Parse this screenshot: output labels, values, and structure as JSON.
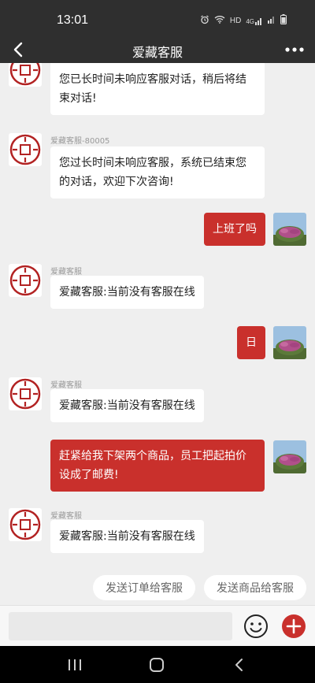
{
  "status_bar": {
    "time": "13:01",
    "icons": [
      "alarm-icon",
      "wifi-icon",
      "hd-icon",
      "signal-4g-icon",
      "signal-icon",
      "battery-icon"
    ],
    "hd_text": "HD",
    "net_text": "4G"
  },
  "header": {
    "title": "爱藏客服",
    "back_icon": "chevron-left-icon",
    "more_icon": "more-dots-icon"
  },
  "messages": [
    {
      "side": "left",
      "sender": "",
      "text_lines": [
        "您已长时间未响应客服对话，稍后将结",
        "束对话!"
      ]
    },
    {
      "side": "left",
      "sender": "爱藏客服-80005",
      "text_lines": [
        "您过长时间未响应客服，系统已结束您",
        "的对话，欢迎下次咨询!"
      ]
    },
    {
      "side": "right",
      "text_lines": [
        "上班了吗"
      ]
    },
    {
      "side": "left",
      "sender": "爱藏客服",
      "text_lines": [
        "爱藏客服:当前没有客服在线"
      ]
    },
    {
      "side": "right",
      "text_lines": [
        "日"
      ]
    },
    {
      "side": "left",
      "sender": "爱藏客服",
      "text_lines": [
        "爱藏客服:当前没有客服在线"
      ]
    },
    {
      "side": "right",
      "text_lines": [
        "赶紧给我下架两个商品，员工把起拍价",
        "设成了邮费!"
      ]
    },
    {
      "side": "left",
      "sender": "爱藏客服",
      "text_lines": [
        "爱藏客服:当前没有客服在线"
      ]
    }
  ],
  "quick_actions": {
    "send_order": "发送订单给客服",
    "send_product": "发送商品给客服"
  },
  "input_bar": {
    "value": "",
    "placeholder": "",
    "emoji_icon": "emoji-smile-icon",
    "plus_icon": "plus-circle-icon"
  },
  "system_nav": {
    "recents_icon": "recents-icon",
    "home_icon": "home-icon",
    "back_icon": "back-icon"
  },
  "colors": {
    "top_bar": "#2f2f2f",
    "accent": "#c9302c",
    "chat_bg": "#efefef",
    "bubble_left": "#ffffff"
  }
}
